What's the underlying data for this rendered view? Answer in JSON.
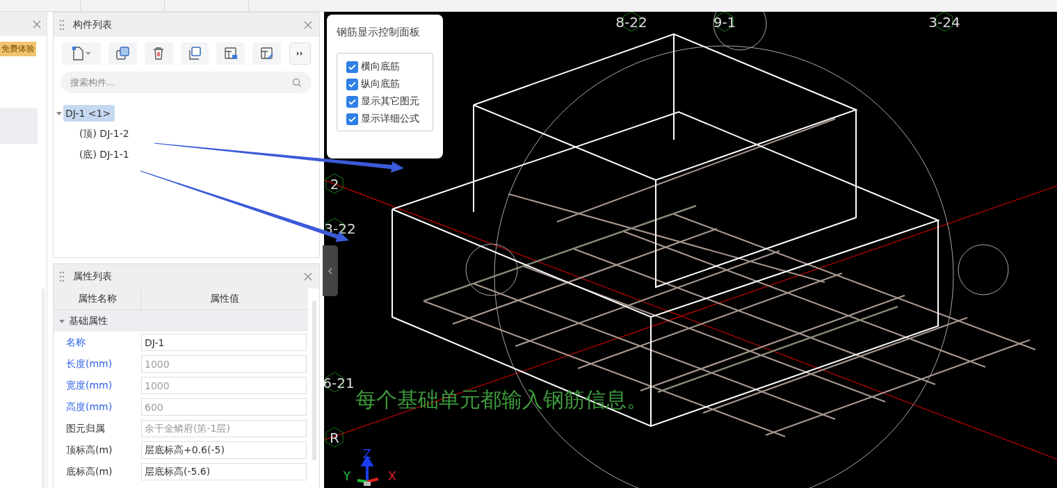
{
  "left_panel": {
    "badge": "免费体验"
  },
  "component_panel": {
    "title": "构件列表",
    "search": {
      "placeholder": "搜索构件..."
    },
    "tree": [
      {
        "label": "DJ-1 <1>",
        "selected": true,
        "expanded": true,
        "children": [
          {
            "label": "(顶) DJ-1-2",
            "selected": false
          },
          {
            "label": "(底) DJ-1-1",
            "selected": false
          }
        ]
      }
    ]
  },
  "property_panel": {
    "title": "属性列表",
    "columns": [
      "属性名称",
      "属性值"
    ],
    "groups": [
      {
        "label": "基础属性",
        "expanded": true,
        "rows": [
          {
            "name": "名称",
            "value": "DJ-1",
            "color": "#2b5fe6",
            "readonly": false
          },
          {
            "name": "长度(mm)",
            "value": "1000",
            "color": "#2b5fe6",
            "readonly": true
          },
          {
            "name": "宽度(mm)",
            "value": "1000",
            "color": "#2b5fe6",
            "readonly": true
          },
          {
            "name": "高度(mm)",
            "value": "600",
            "color": "#2b5fe6",
            "readonly": true
          },
          {
            "name": "图元归属",
            "value": "余干金鳞府(第-1层)",
            "color": "#333333",
            "readonly": true
          },
          {
            "name": "顶标高(m)",
            "value": "层底标高+0.6(-5)",
            "color": "#333333",
            "readonly": false
          },
          {
            "name": "底标高(m)",
            "value": "层底标高(-5.6)",
            "color": "#333333",
            "readonly": false
          }
        ]
      }
    ]
  },
  "rebar_panel": {
    "title": "钢筋显示控制面板",
    "options": [
      {
        "label": "横向底筋",
        "checked": true
      },
      {
        "label": "纵向底筋",
        "checked": true
      },
      {
        "label": "显示其它图元",
        "checked": true
      },
      {
        "label": "显示详细公式",
        "checked": true
      }
    ]
  },
  "viewport": {
    "grid_labels": [
      {
        "text": "8-22"
      },
      {
        "text": "9-1"
      },
      {
        "text": "3-24"
      },
      {
        "text": "2"
      },
      {
        "text": "3-22"
      },
      {
        "text": "6-21"
      },
      {
        "text": "R"
      }
    ],
    "caption": "每个基础单元都输入钢筋信息。",
    "axes": [
      {
        "label": "Z"
      },
      {
        "label": "Y"
      },
      {
        "label": "X"
      }
    ]
  }
}
